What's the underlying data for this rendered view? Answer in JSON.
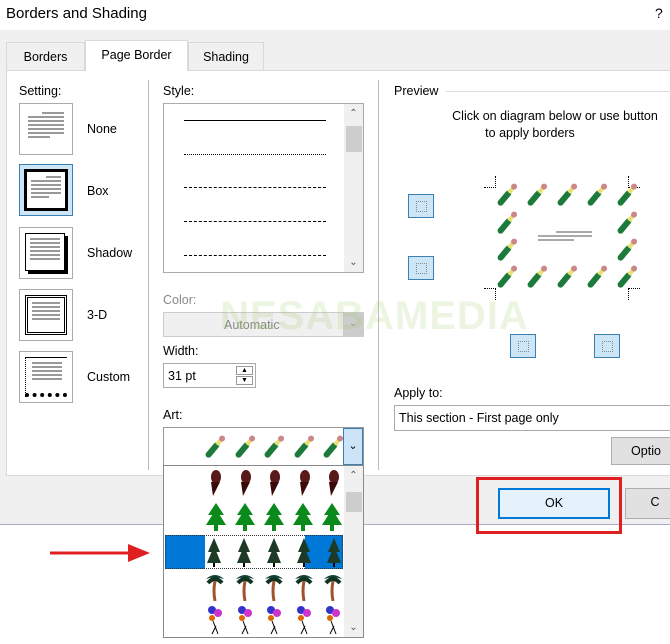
{
  "window": {
    "title": "Borders and Shading",
    "help": "?"
  },
  "tabs": [
    {
      "label": "Borders"
    },
    {
      "label": "Page Border"
    },
    {
      "label": "Shading"
    }
  ],
  "setting": {
    "label": "Setting:",
    "items": [
      {
        "label": "None"
      },
      {
        "label": "Box"
      },
      {
        "label": "Shadow"
      },
      {
        "label": "3-D"
      },
      {
        "label": "Custom"
      }
    ],
    "selected": "Box"
  },
  "style": {
    "label": "Style:"
  },
  "color": {
    "label": "Color:",
    "value": "Automatic"
  },
  "width": {
    "label": "Width:",
    "value": "31 pt"
  },
  "art": {
    "label": "Art:",
    "selected": "champagne-bottles",
    "options": [
      "champagne-bottles",
      "ice-cream-cones",
      "pine-trees",
      "dark-pine-trees",
      "palm-trees",
      "balloons"
    ],
    "highlighted": "dark-pine-trees"
  },
  "preview": {
    "label": "Preview",
    "instruction_line1": "Click on diagram below or use button",
    "instruction_line2": "to apply borders"
  },
  "apply_to": {
    "label": "Apply to:",
    "value": "This section - First page only"
  },
  "buttons": {
    "options": "Optio",
    "ok": "OK",
    "cancel": "C"
  },
  "watermark": "NESABAMEDIA",
  "colors": {
    "accent": "#0078d7",
    "highlight_outline": "#e02020",
    "arrow": "#e02020"
  }
}
